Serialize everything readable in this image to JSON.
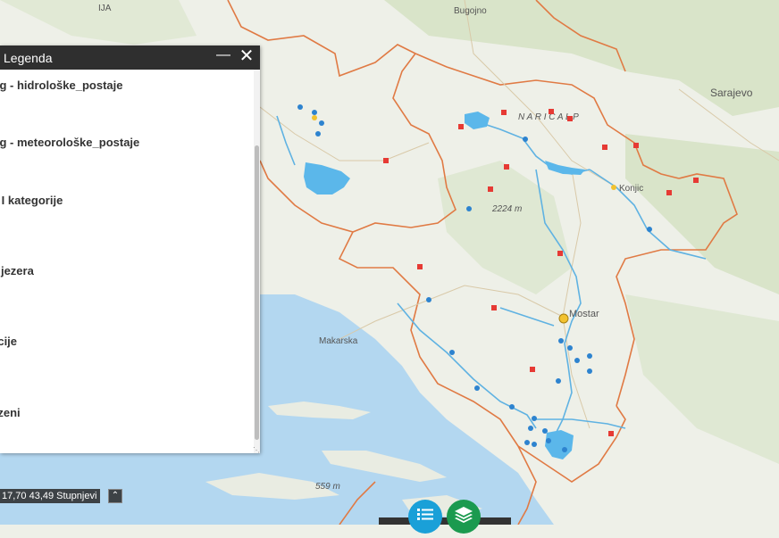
{
  "legend": {
    "title": "Legenda",
    "minimize_icon": "minimize-icon",
    "close_icon": "close-icon",
    "items": [
      {
        "label": "itoring - hidrološke_postaje"
      },
      {
        "label": "itoring - meteorološke_postaje"
      },
      {
        "label": "otoci I kategorije"
      },
      {
        "label": "edna jezera"
      },
      {
        "label": "mulacije"
      },
      {
        "label": "ni bazeni"
      }
    ]
  },
  "map": {
    "place_labels": {
      "bugojno": "Bugojno",
      "sarajevo": "Sarajevo",
      "konjic": "Konjic",
      "mostar": "Mostar",
      "makarska": "Makarska",
      "naric_alp": "N A R I C   A L P",
      "peak_2224": "2224 m",
      "peak_559": "559 m",
      "top_left_label": "IJA"
    },
    "colors": {
      "land": "#eef0e8",
      "forest": "#d6e2c6",
      "sea": "#b3d7f0",
      "border": "#e07a44",
      "river": "#5fb2e2",
      "hydro_station": "#2d83cf",
      "meteo_station": "#e63a34",
      "city_marker": "#f2c230"
    }
  },
  "coords": {
    "text": "17,70 43,49 Stupnjevi",
    "toggle_icon": "chevron-up-icon"
  },
  "toolbar": {
    "legend_icon": "legend-list-icon",
    "layers_icon": "layers-icon"
  }
}
